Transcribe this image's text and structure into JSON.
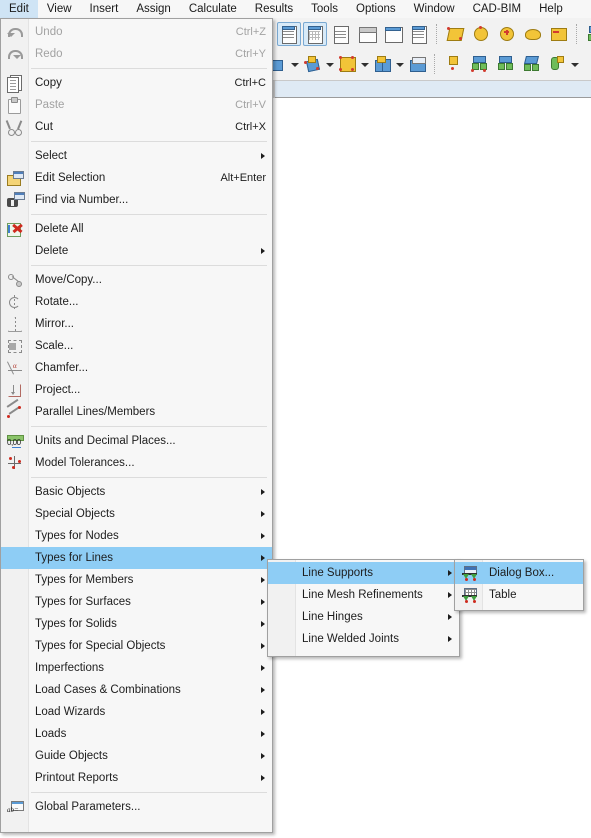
{
  "menubar": {
    "items": [
      {
        "label": "Edit",
        "active": true
      },
      {
        "label": "View",
        "active": false
      },
      {
        "label": "Insert",
        "active": false
      },
      {
        "label": "Assign",
        "active": false
      },
      {
        "label": "Calculate",
        "active": false
      },
      {
        "label": "Results",
        "active": false
      },
      {
        "label": "Tools",
        "active": false
      },
      {
        "label": "Options",
        "active": false
      },
      {
        "label": "Window",
        "active": false
      },
      {
        "label": "CAD-BIM",
        "active": false
      },
      {
        "label": "Help",
        "active": false
      }
    ]
  },
  "toolbar": {
    "row1": [
      {
        "icon": "navigator-icon",
        "selected": true
      },
      {
        "icon": "table-grid-icon",
        "selected": true
      },
      {
        "icon": "list-report-icon",
        "selected": false
      },
      {
        "icon": "command-prompt-icon",
        "selected": false
      },
      {
        "icon": "script-sc-icon",
        "selected": false
      },
      {
        "icon": "panel-icon",
        "selected": false
      },
      {
        "icon": "select-polygon-icon",
        "selected": false
      },
      {
        "icon": "select-circle-icon",
        "selected": false
      },
      {
        "icon": "select-special-icon",
        "selected": false
      },
      {
        "icon": "lasso-select-icon",
        "selected": false
      },
      {
        "icon": "select-plus-icon",
        "selected": false
      },
      {
        "icon": "support-partial-icon",
        "selected": false
      }
    ],
    "row2": [
      {
        "icon": "solid-object-icon",
        "dropdown": true
      },
      {
        "icon": "node-object-icon",
        "dropdown": true
      },
      {
        "icon": "surface-object-icon",
        "dropdown": true
      },
      {
        "icon": "member-object-icon",
        "dropdown": true
      },
      {
        "icon": "solid-block-icon",
        "dropdown": false
      },
      {
        "icon": "nodal-support-icon",
        "dropdown": false
      },
      {
        "icon": "line-support-icon",
        "dropdown": false
      },
      {
        "icon": "member-support-icon",
        "dropdown": false
      },
      {
        "icon": "surface-support-icon",
        "dropdown": false
      },
      {
        "icon": "hinge-icon",
        "dropdown": true
      }
    ]
  },
  "edit_menu": {
    "groups": [
      {
        "items": [
          {
            "label": "Undo",
            "accel": "Ctrl+Z",
            "icon": "undo-icon",
            "disabled": true,
            "submenu": false
          },
          {
            "label": "Redo",
            "accel": "Ctrl+Y",
            "icon": "redo-icon",
            "disabled": true,
            "submenu": false
          }
        ]
      },
      {
        "items": [
          {
            "label": "Copy",
            "accel": "Ctrl+C",
            "icon": "copy-icon",
            "disabled": false,
            "submenu": false
          },
          {
            "label": "Paste",
            "accel": "Ctrl+V",
            "icon": "paste-icon",
            "disabled": true,
            "submenu": false
          },
          {
            "label": "Cut",
            "accel": "Ctrl+X",
            "icon": "cut-icon",
            "disabled": false,
            "submenu": false
          }
        ]
      },
      {
        "items": [
          {
            "label": "Select",
            "accel": "",
            "icon": "",
            "disabled": false,
            "submenu": true
          },
          {
            "label": "Edit Selection",
            "accel": "Alt+Enter",
            "icon": "edit-selection-icon",
            "disabled": false,
            "submenu": false
          },
          {
            "label": "Find via Number...",
            "accel": "",
            "icon": "find-via-number-icon",
            "disabled": false,
            "submenu": false
          }
        ]
      },
      {
        "items": [
          {
            "label": "Delete All",
            "accel": "",
            "icon": "delete-all-icon",
            "disabled": false,
            "submenu": false
          },
          {
            "label": "Delete",
            "accel": "",
            "icon": "",
            "disabled": false,
            "submenu": true
          }
        ]
      },
      {
        "items": [
          {
            "label": "Move/Copy...",
            "accel": "",
            "icon": "move-copy-icon",
            "disabled": false,
            "submenu": false
          },
          {
            "label": "Rotate...",
            "accel": "",
            "icon": "rotate-icon",
            "disabled": false,
            "submenu": false
          },
          {
            "label": "Mirror...",
            "accel": "",
            "icon": "mirror-icon",
            "disabled": false,
            "submenu": false
          },
          {
            "label": "Scale...",
            "accel": "",
            "icon": "scale-icon",
            "disabled": false,
            "submenu": false
          },
          {
            "label": "Chamfer...",
            "accel": "",
            "icon": "chamfer-icon",
            "disabled": false,
            "submenu": false
          },
          {
            "label": "Project...",
            "accel": "",
            "icon": "project-icon",
            "disabled": false,
            "submenu": false
          },
          {
            "label": "Parallel Lines/Members",
            "accel": "",
            "icon": "parallel-lines-icon",
            "disabled": false,
            "submenu": false
          }
        ]
      },
      {
        "items": [
          {
            "label": "Units and Decimal Places...",
            "accel": "",
            "icon": "units-icon",
            "disabled": false,
            "submenu": false
          },
          {
            "label": "Model Tolerances...",
            "accel": "",
            "icon": "model-tolerances-icon",
            "disabled": false,
            "submenu": false
          }
        ]
      },
      {
        "items": [
          {
            "label": "Basic Objects",
            "accel": "",
            "icon": "",
            "disabled": false,
            "submenu": true
          },
          {
            "label": "Special Objects",
            "accel": "",
            "icon": "",
            "disabled": false,
            "submenu": true
          },
          {
            "label": "Types for Nodes",
            "accel": "",
            "icon": "",
            "disabled": false,
            "submenu": true
          },
          {
            "label": "Types for Lines",
            "accel": "",
            "icon": "",
            "disabled": false,
            "submenu": true,
            "highlighted": true
          },
          {
            "label": "Types for Members",
            "accel": "",
            "icon": "",
            "disabled": false,
            "submenu": true
          },
          {
            "label": "Types for Surfaces",
            "accel": "",
            "icon": "",
            "disabled": false,
            "submenu": true
          },
          {
            "label": "Types for Solids",
            "accel": "",
            "icon": "",
            "disabled": false,
            "submenu": true
          },
          {
            "label": "Types for Special Objects",
            "accel": "",
            "icon": "",
            "disabled": false,
            "submenu": true
          },
          {
            "label": "Imperfections",
            "accel": "",
            "icon": "",
            "disabled": false,
            "submenu": true
          },
          {
            "label": "Load Cases & Combinations",
            "accel": "",
            "icon": "",
            "disabled": false,
            "submenu": true
          },
          {
            "label": "Load Wizards",
            "accel": "",
            "icon": "",
            "disabled": false,
            "submenu": true
          },
          {
            "label": "Loads",
            "accel": "",
            "icon": "",
            "disabled": false,
            "submenu": true
          },
          {
            "label": "Guide Objects",
            "accel": "",
            "icon": "",
            "disabled": false,
            "submenu": true
          },
          {
            "label": "Printout Reports",
            "accel": "",
            "icon": "",
            "disabled": false,
            "submenu": true
          }
        ]
      },
      {
        "items": [
          {
            "label": "Global Parameters...",
            "accel": "",
            "icon": "global-parameters-icon",
            "disabled": false,
            "submenu": false
          }
        ]
      }
    ]
  },
  "types_for_lines_submenu": {
    "items": [
      {
        "label": "Line Supports",
        "submenu": true,
        "highlighted": true
      },
      {
        "label": "Line Mesh Refinements",
        "submenu": true,
        "highlighted": false
      },
      {
        "label": "Line Hinges",
        "submenu": true,
        "highlighted": false
      },
      {
        "label": "Line Welded Joints",
        "submenu": true,
        "highlighted": false
      }
    ]
  },
  "line_supports_submenu": {
    "items": [
      {
        "label": "Dialog Box...",
        "icon": "line-support-dialog-icon",
        "highlighted": true
      },
      {
        "label": "Table",
        "icon": "line-support-table-icon",
        "highlighted": false
      }
    ]
  },
  "colors": {
    "menu_background": "#f7f7f7",
    "menu_highlight": "#8ecdf5",
    "menubar_active": "#cfe4f5",
    "toolbar_background": "#f2f2f2",
    "document_band": "#dfeaf4",
    "canvas": "#ffffff",
    "disabled_text": "#a2a2a2",
    "text": "#1d1d1d"
  }
}
